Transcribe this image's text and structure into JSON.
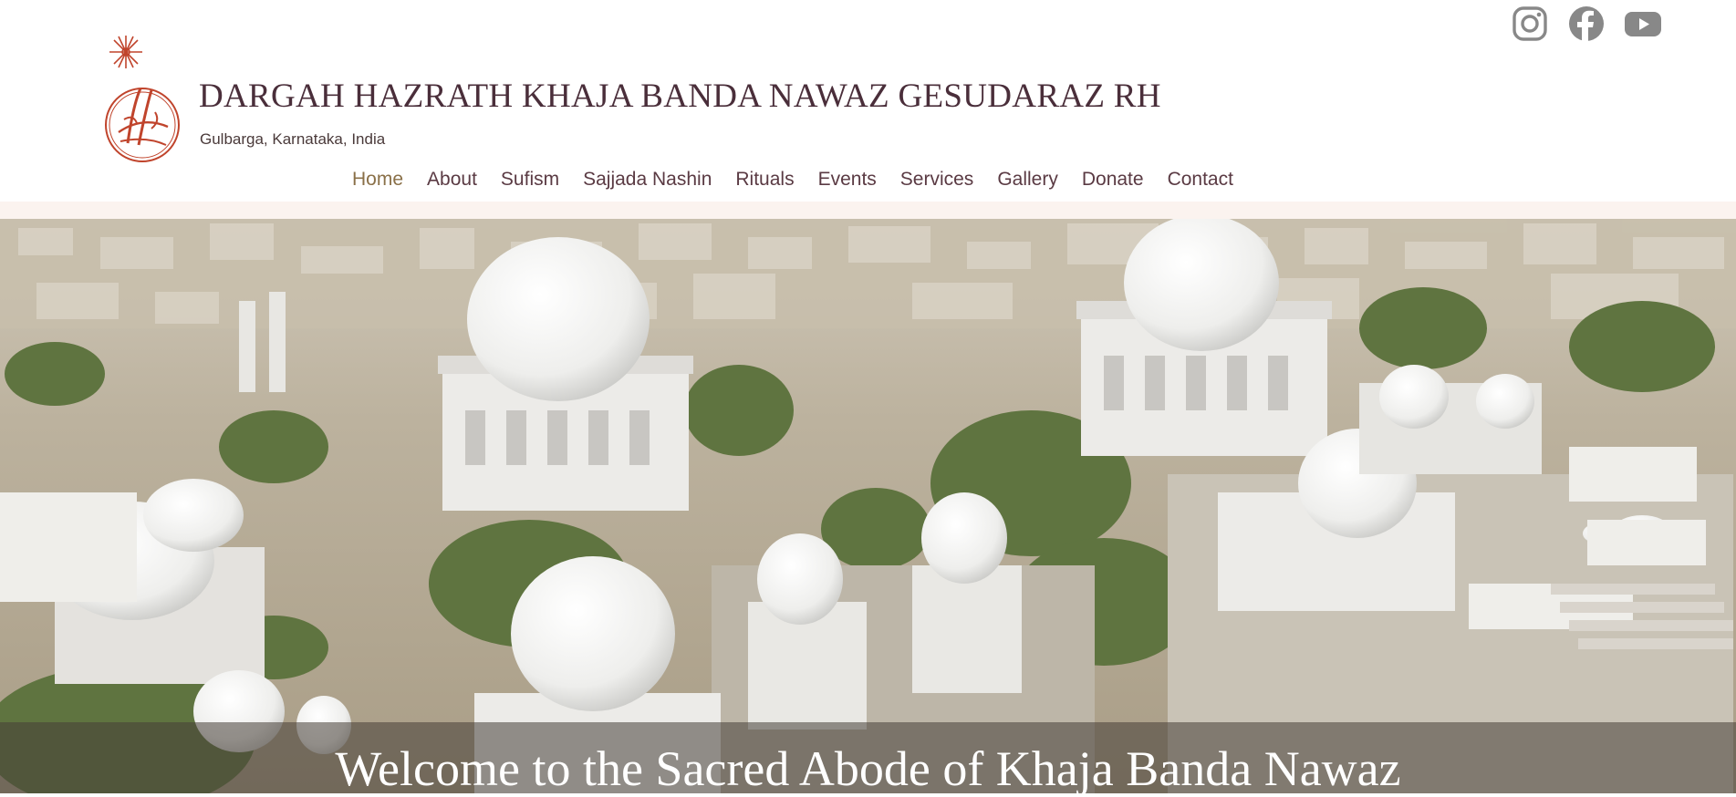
{
  "site": {
    "title": "DARGAH HAZRATH KHAJA BANDA NAWAZ GESUDARAZ RH",
    "subtitle": "Gulbarga, Karnataka, India"
  },
  "social": [
    {
      "icon": "instagram-icon"
    },
    {
      "icon": "facebook-icon"
    },
    {
      "icon": "youtube-icon"
    }
  ],
  "nav": {
    "items": [
      "Home",
      "About",
      "Sufism",
      "Sajjada Nashin",
      "Rituals",
      "Events",
      "Services",
      "Gallery",
      "Donate",
      "Contact"
    ],
    "active": "Home"
  },
  "hero": {
    "caption": "Welcome to the Sacred Abode of Khaja Banda Nawaz"
  },
  "colors": {
    "title": "#4a2e3a",
    "nav_active": "#8a7048",
    "logo": "#c0442c",
    "icon_gray": "#888888"
  }
}
